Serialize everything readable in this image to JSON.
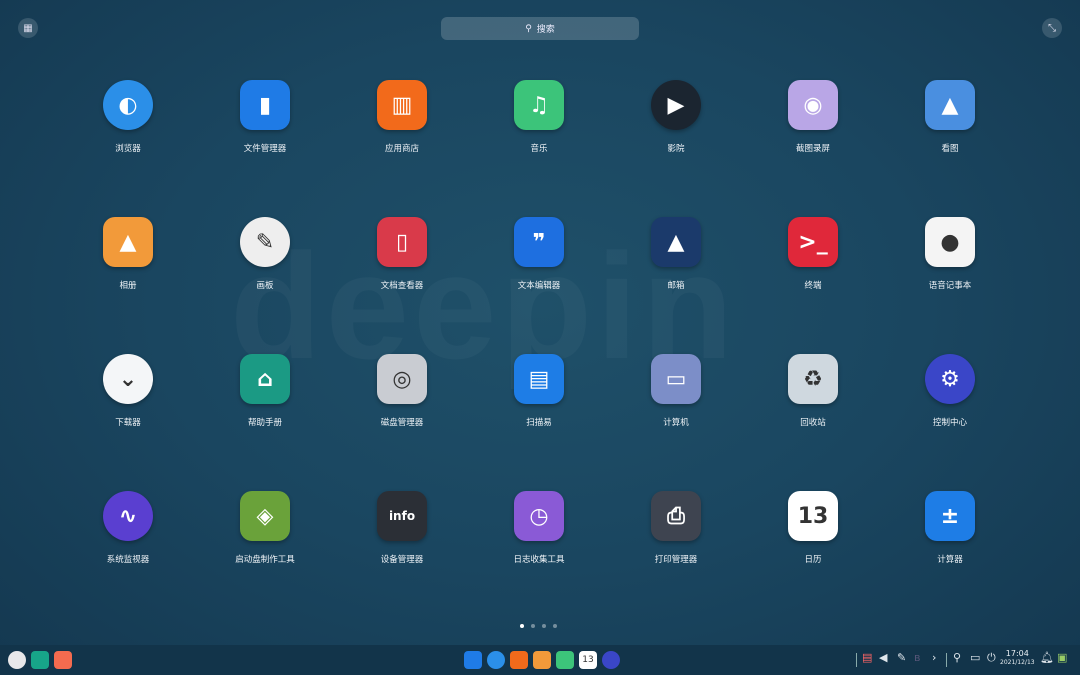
{
  "brand_watermark": "deepin",
  "search": {
    "placeholder": "搜索",
    "icon": "search-icon"
  },
  "apps": [
    {
      "label": "浏览器",
      "color": "#2b8fe8",
      "glyph": "◐",
      "shape": "circle"
    },
    {
      "label": "文件管理器",
      "color": "#1f7be6",
      "glyph": "▮"
    },
    {
      "label": "应用商店",
      "color": "#f26a1b",
      "glyph": "▥"
    },
    {
      "label": "音乐",
      "color": "#3cc47a",
      "glyph": "♫"
    },
    {
      "label": "影院",
      "color": "#1b2530",
      "glyph": "▶",
      "shape": "circle"
    },
    {
      "label": "截图录屏",
      "color": "#b9a6e6",
      "glyph": "◉"
    },
    {
      "label": "看图",
      "color": "#4a8fe0",
      "glyph": "▲"
    },
    {
      "label": "相册",
      "color": "#f29a3a",
      "glyph": "▲"
    },
    {
      "label": "画板",
      "color": "#eeeeee",
      "glyph": "✎",
      "shape": "circle",
      "dark": true
    },
    {
      "label": "文档查看器",
      "color": "#d93a4a",
      "glyph": "▯"
    },
    {
      "label": "文本编辑器",
      "color": "#1e6fe0",
      "glyph": "❞"
    },
    {
      "label": "邮箱",
      "color": "#1b3a6b",
      "glyph": "▲"
    },
    {
      "label": "终端",
      "color": "#e0283a",
      "glyph": ">_"
    },
    {
      "label": "语音记事本",
      "color": "#f4f4f4",
      "glyph": "●",
      "dark": true
    },
    {
      "label": "下载器",
      "color": "#f4f6f8",
      "glyph": "⌄",
      "shape": "circle",
      "dark": true
    },
    {
      "label": "帮助手册",
      "color": "#1b9a84",
      "glyph": "⌂"
    },
    {
      "label": "磁盘管理器",
      "color": "#c9ccd2",
      "glyph": "◎",
      "dark": true
    },
    {
      "label": "扫描易",
      "color": "#1e7de6",
      "glyph": "▤"
    },
    {
      "label": "计算机",
      "color": "#7c8ec8",
      "glyph": "▭"
    },
    {
      "label": "回收站",
      "color": "#cfd8df",
      "glyph": "♻",
      "dark": true
    },
    {
      "label": "控制中心",
      "color": "#3a46c8",
      "glyph": "⚙",
      "shape": "circle"
    },
    {
      "label": "系统监视器",
      "color": "#5a3fd0",
      "glyph": "∿",
      "shape": "circle"
    },
    {
      "label": "启动盘制作工具",
      "color": "#6aa23a",
      "glyph": "◈"
    },
    {
      "label": "设备管理器",
      "color": "#2b2f36",
      "glyph": "info"
    },
    {
      "label": "日志收集工具",
      "color": "#8a5ad6",
      "glyph": "◷"
    },
    {
      "label": "打印管理器",
      "color": "#3e4450",
      "glyph": "⎙"
    },
    {
      "label": "日历",
      "color": "#ffffff",
      "glyph": "13",
      "dark": true
    },
    {
      "label": "计算器",
      "color": "#1e7de6",
      "glyph": "±"
    }
  ],
  "pagination": {
    "pages": 4,
    "current": 1
  },
  "taskbar": {
    "left": [
      {
        "name": "launcher",
        "color": "#e8e8ea"
      },
      {
        "name": "multitask-view",
        "color": "#17a589"
      },
      {
        "name": "workspace",
        "color": "#f46b4f"
      }
    ],
    "dock": [
      {
        "name": "file-manager",
        "color": "#1f7be6"
      },
      {
        "name": "browser",
        "color": "#2b8fe8"
      },
      {
        "name": "app-store",
        "color": "#f26a1b"
      },
      {
        "name": "album",
        "color": "#f29a3a"
      },
      {
        "name": "music",
        "color": "#3cc47a"
      },
      {
        "name": "calendar",
        "color": "#ffffff",
        "text": "13"
      },
      {
        "name": "control-center",
        "color": "#3a46c8"
      }
    ],
    "clock": {
      "time": "17:04",
      "date": "2021/12/13"
    }
  }
}
